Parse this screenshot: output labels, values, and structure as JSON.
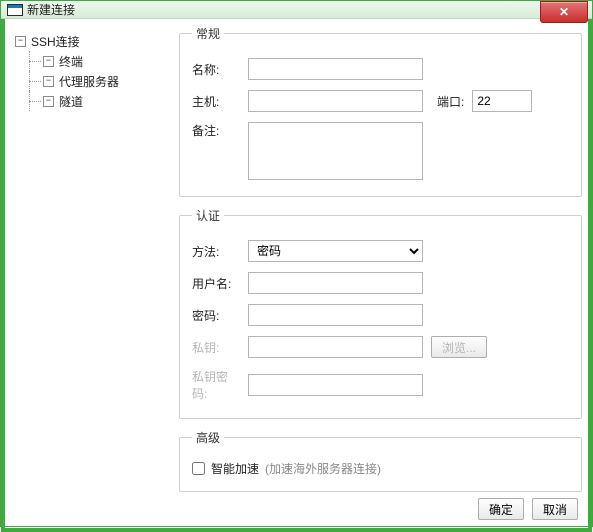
{
  "window": {
    "title": "新建连接",
    "close_glyph": "✕"
  },
  "tree": {
    "toggler_minus": "−",
    "root": "SSH连接",
    "children": [
      "终端",
      "代理服务器",
      "隧道"
    ]
  },
  "groups": {
    "general": "常规",
    "auth": "认证",
    "advanced": "高级"
  },
  "labels": {
    "name": "名称:",
    "host": "主机:",
    "port": "端口:",
    "note": "备注:",
    "method": "方法:",
    "username": "用户名:",
    "password": "密码:",
    "private_key": "私钥:",
    "pk_pass": "私钥密码:",
    "browse": "浏览...",
    "smart_accel": "智能加速",
    "smart_accel_hint": "(加速海外服务器连接)"
  },
  "values": {
    "name": "",
    "host": "",
    "port": "22",
    "note": "",
    "method_selected": "密码",
    "username": "",
    "password": "",
    "private_key": "",
    "pk_pass": "",
    "smart_accel_checked": false
  },
  "footer": {
    "ok": "确定",
    "cancel": "取消"
  }
}
